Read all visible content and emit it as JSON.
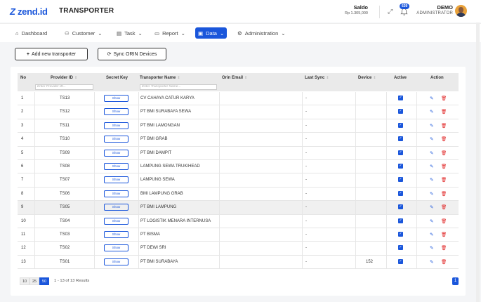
{
  "header": {
    "logo": "zend.id",
    "app_title": "TRANSPORTER",
    "saldo_label": "Saldo",
    "saldo_value": "Rp 1.305,000",
    "notif_count": "639",
    "user_name": "DEMO",
    "user_role": "ADMINISTRATOR"
  },
  "nav": {
    "items": [
      {
        "label": "Dashboard",
        "icon": "home-icon"
      },
      {
        "label": "Customer",
        "icon": "users-icon"
      },
      {
        "label": "Task",
        "icon": "file-icon"
      },
      {
        "label": "Report",
        "icon": "folder-icon"
      },
      {
        "label": "Data",
        "icon": "database-icon"
      },
      {
        "label": "Administration",
        "icon": "gear-icon"
      }
    ]
  },
  "toolbar": {
    "add_label": "Add new transporter",
    "sync_label": "Sync ORIN Devices"
  },
  "table": {
    "headers": {
      "no": "No",
      "provider_id": "Provider ID",
      "secret_key": "Secret Key",
      "transporter_name": "Transporter Name",
      "orin_email": "Orin Email",
      "last_sync": "Last Sync",
      "device": "Device",
      "active": "Active",
      "action": "Action"
    },
    "provider_placeholder": "Enter Provider ID...",
    "name_placeholder": "Enter Transporter Name...",
    "show_label": "Show",
    "rows": [
      {
        "no": "1",
        "id": "TS13",
        "name": "CV CAHAYA CATUR KARYA",
        "email": "",
        "sync": "-",
        "device": ""
      },
      {
        "no": "2",
        "id": "TS12",
        "name": "PT BMI SURABAYA SEWA",
        "email": "",
        "sync": "-",
        "device": ""
      },
      {
        "no": "3",
        "id": "TS11",
        "name": "PT BMI LAMONGAN",
        "email": "",
        "sync": "-",
        "device": ""
      },
      {
        "no": "4",
        "id": "TS10",
        "name": "PT BMI GRAB",
        "email": "",
        "sync": "-",
        "device": ""
      },
      {
        "no": "5",
        "id": "TS09",
        "name": "PT BMI DAMPIT",
        "email": "",
        "sync": "-",
        "device": ""
      },
      {
        "no": "6",
        "id": "TS08",
        "name": "LAMPUNG SEWA TRUK/HEAD",
        "email": "",
        "sync": "-",
        "device": ""
      },
      {
        "no": "7",
        "id": "TS07",
        "name": "LAMPUNG SEWA",
        "email": "",
        "sync": "-",
        "device": ""
      },
      {
        "no": "8",
        "id": "TS06",
        "name": "BMI LAMPUNG GRAB",
        "email": "",
        "sync": "-",
        "device": ""
      },
      {
        "no": "9",
        "id": "TS05",
        "name": "PT BMI LAMPUNG",
        "email": "",
        "sync": "-",
        "device": ""
      },
      {
        "no": "10",
        "id": "TS04",
        "name": "PT LOGISTIK MENARA INTERNUSA",
        "email": "",
        "sync": "-",
        "device": ""
      },
      {
        "no": "11",
        "id": "TS03",
        "name": "PT BISMA",
        "email": "",
        "sync": "-",
        "device": ""
      },
      {
        "no": "12",
        "id": "TS02",
        "name": "PT DEWI SRI",
        "email": "",
        "sync": "-",
        "device": ""
      },
      {
        "no": "13",
        "id": "TS01",
        "name": "PT BMI SURABAYA",
        "email": "",
        "sync": "-",
        "device": "152"
      }
    ]
  },
  "pagination": {
    "sizes": [
      "10",
      "25",
      "50"
    ],
    "active_size": "50",
    "results_text": "1 - 13 of 13 Results",
    "current_page": "1"
  }
}
